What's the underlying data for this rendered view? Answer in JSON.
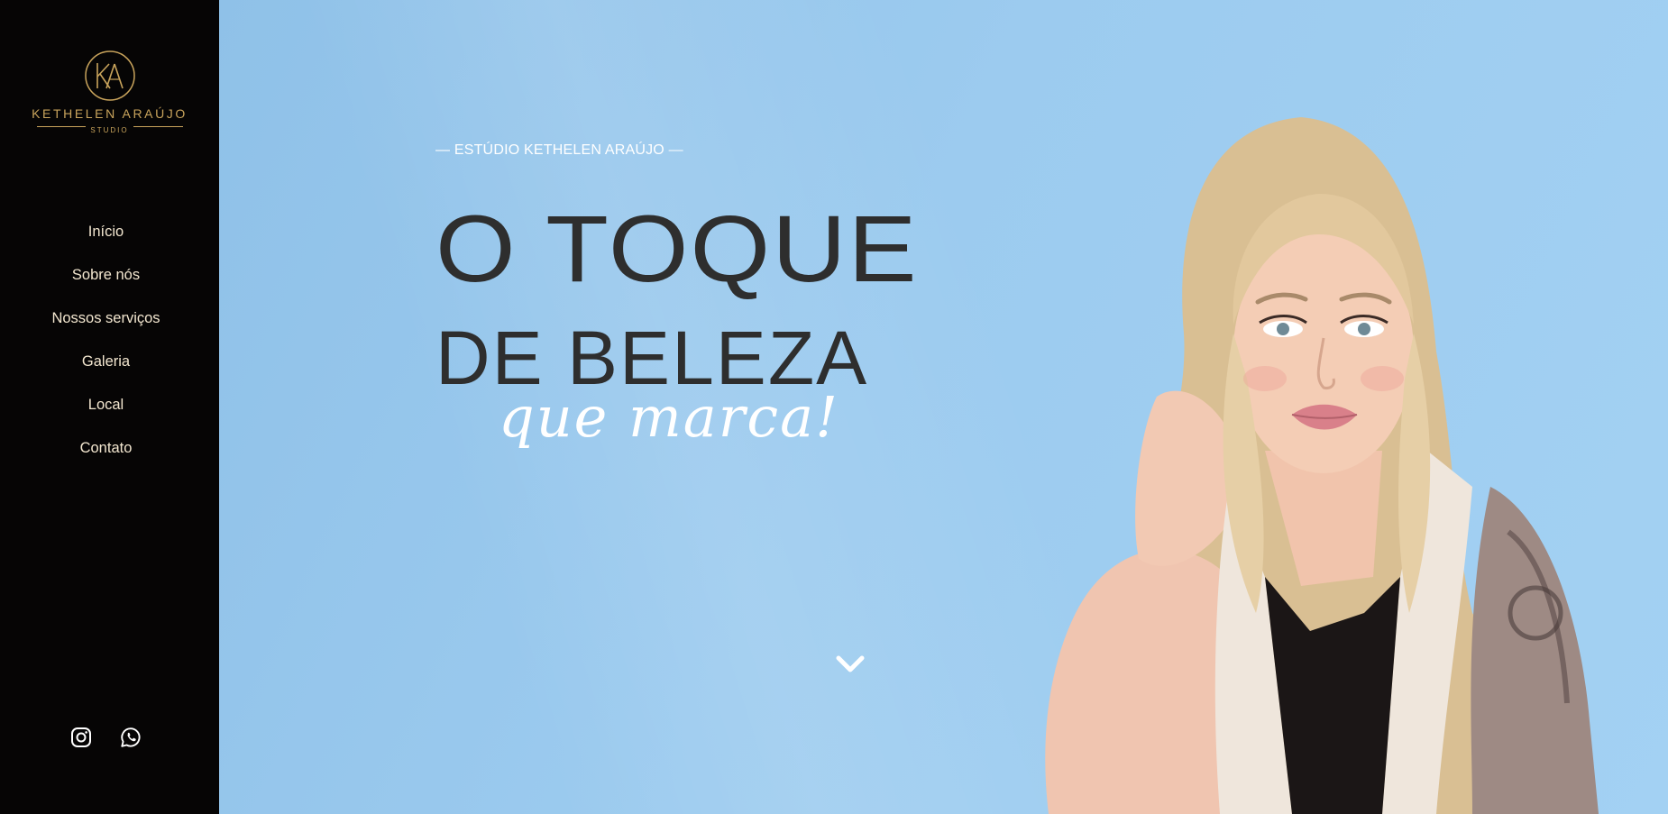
{
  "brand": {
    "monogram": "KA",
    "name": "KETHELEN ARAÚJO",
    "subtitle": "STUDIO",
    "gold_color": "#c9a45c"
  },
  "nav": {
    "items": [
      {
        "label": "Início"
      },
      {
        "label": "Sobre nós"
      },
      {
        "label": "Nossos serviços"
      },
      {
        "label": "Galeria"
      },
      {
        "label": "Local"
      },
      {
        "label": "Contato"
      }
    ]
  },
  "social": {
    "instagram_icon": "instagram-icon",
    "whatsapp_icon": "whatsapp-icon"
  },
  "hero": {
    "eyebrow": "— ESTÚDIO KETHELEN ARAÚJO —",
    "headline_line1": "O TOQUE",
    "headline_line2": "DE BELEZA",
    "headline_script": "que marca!",
    "scroll_icon": "chevron-down-icon",
    "background_color": "#9ccbef"
  }
}
